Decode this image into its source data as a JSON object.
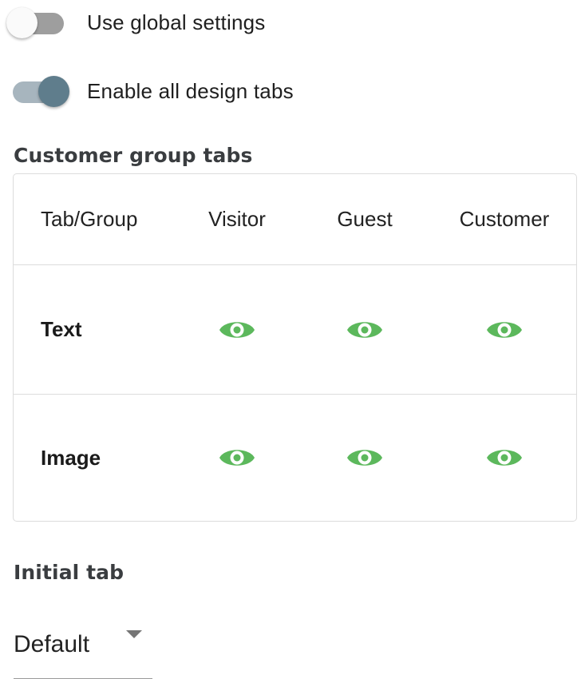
{
  "settings": {
    "use_global": {
      "label": "Use global settings",
      "checked": false
    },
    "enable_all_tabs": {
      "label": "Enable all design tabs",
      "checked": true
    }
  },
  "customer_group_tabs": {
    "title": "Customer group tabs",
    "columns": [
      "Tab/Group",
      "Visitor",
      "Guest",
      "Customer"
    ],
    "rows": [
      {
        "label": "Text",
        "visibility": [
          "eye-icon",
          "eye-icon",
          "eye-icon"
        ]
      },
      {
        "label": "Image",
        "visibility": [
          "eye-icon",
          "eye-icon",
          "eye-icon"
        ]
      }
    ],
    "icon_color": "#5cb85c"
  },
  "initial_tab": {
    "title": "Initial tab",
    "selected": "Default"
  }
}
